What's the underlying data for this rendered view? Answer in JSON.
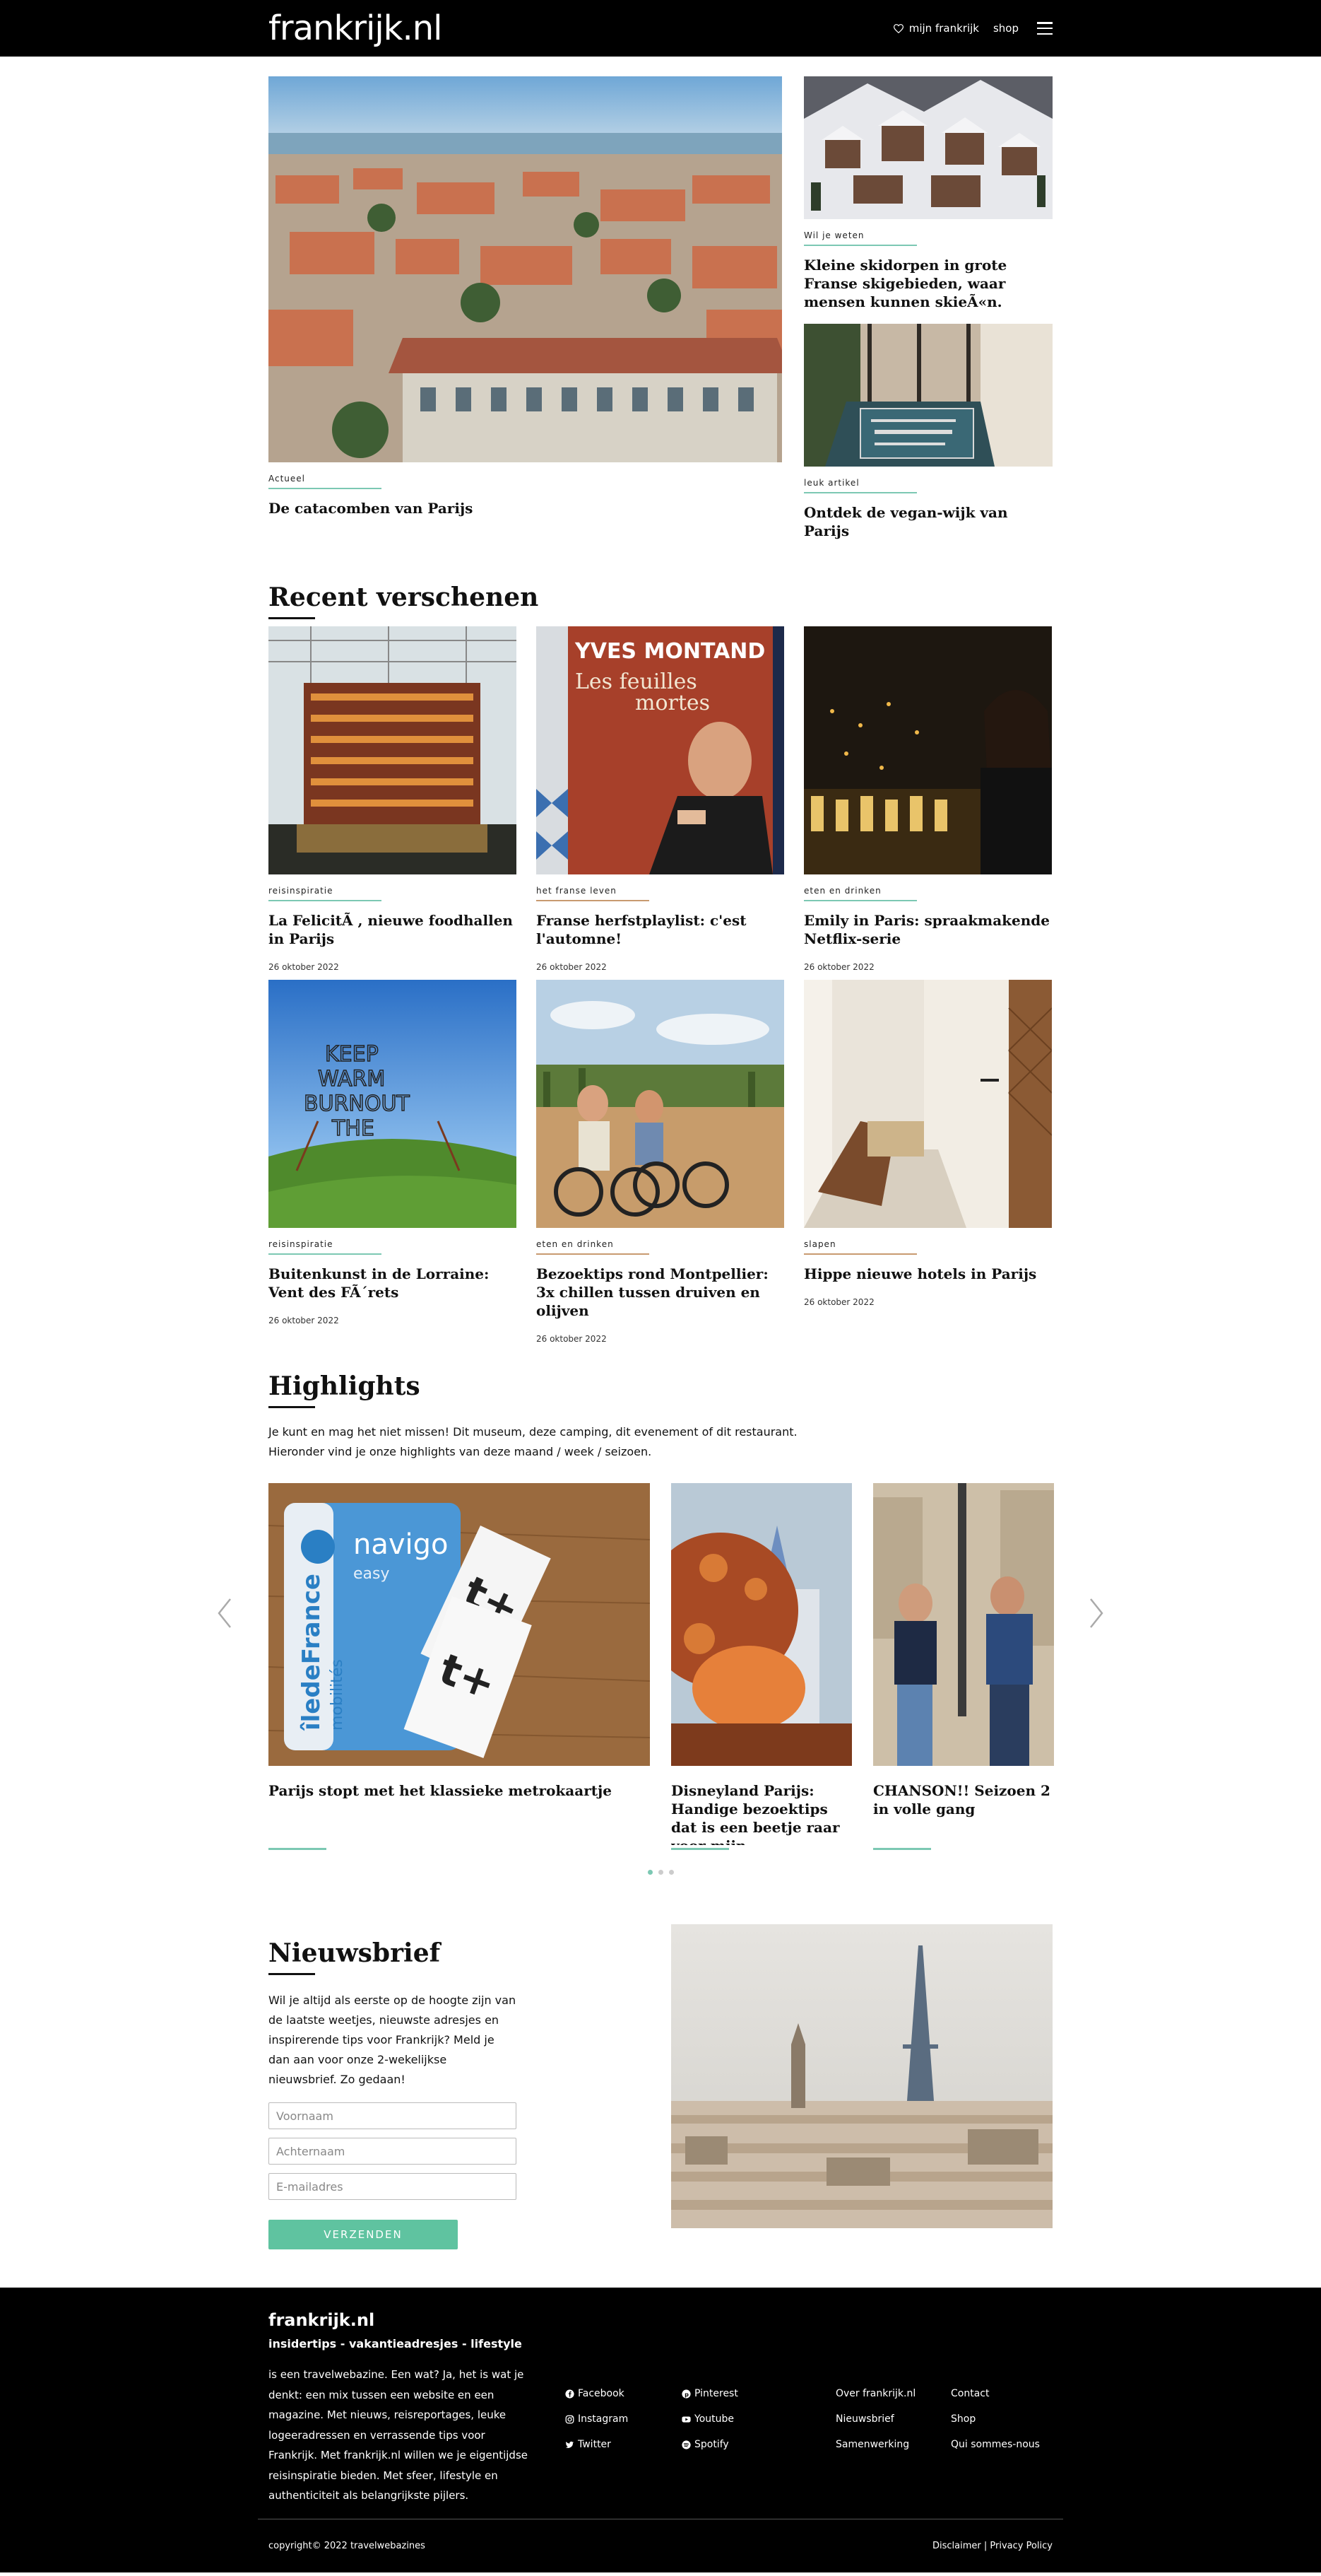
{
  "header": {
    "logo": "frankrijk.nl",
    "mijn_frankrijk": "mijn frankrijk",
    "shop": "shop",
    "heart_icon": "heart-icon",
    "menu_icon": "hamburger-menu-icon"
  },
  "featured": {
    "main": {
      "category": "Actueel",
      "title": "De catacomben van Parijs"
    },
    "side": [
      {
        "category": "Wil je weten",
        "title": "Kleine skidorpen in grote Franse skigebieden, waar mensen kunnen skieÃ«n."
      },
      {
        "category": "leuk artikel",
        "title": "Ontdek de vegan-wijk van Parijs"
      }
    ]
  },
  "recent": {
    "heading": "Recent verschenen",
    "items": [
      {
        "category": "reisinspiratie",
        "title": "La FelicitÃ , nieuwe foodhallen in Parijs",
        "date": "26 oktober 2022",
        "accent": "#7cc8b3"
      },
      {
        "category": "het franse leven",
        "title": "Franse herfstplaylist: c'est l'automne!",
        "date": "26 oktober 2022",
        "accent": "#c89a70"
      },
      {
        "category": "eten en drinken",
        "title": "Emily in Paris: spraakmakende Netflix-serie",
        "date": "26 oktober 2022",
        "accent": "#7cc8b3"
      },
      {
        "category": "reisinspiratie",
        "title": "Buitenkunst in de Lorraine: Vent des FÃ´rets",
        "date": "26 oktober 2022",
        "accent": "#7cc8b3"
      },
      {
        "category": "eten en drinken",
        "title": "Bezoektips rond Montpellier: 3x chillen tussen druiven en olijven",
        "date": "26 oktober 2022",
        "accent": "#c89a70"
      },
      {
        "category": "slapen",
        "title": "Hippe nieuwe hotels in Parijs",
        "date": "26 oktober 2022",
        "accent": "#c89a70"
      }
    ]
  },
  "highlights": {
    "heading": "Highlights",
    "intro_1": "Je kunt en mag het niet missen! Dit museum, deze camping, dit evenement of dit restaurant.",
    "intro_2": "Hieronder vind je onze highlights van deze maand / week / seizoen.",
    "items": [
      {
        "title": "Parijs stopt met het klassieke metrokaartje"
      },
      {
        "title": "Disneyland Parijs: Handige bezoektips dat is een beetje raar voor mijn…"
      },
      {
        "title": "CHANSON!! Seizoen 2 in volle gang"
      }
    ],
    "photo_text": {
      "navigo": "navigo",
      "easy": "easy",
      "idf": "îledeFrance",
      "mobilites": "mobilités"
    },
    "active_slide": 1,
    "slide_count": 3
  },
  "newsletter": {
    "heading": "Nieuwsbrief",
    "text": "Wil je altijd als eerste op de hoogte zijn van de laatste weetjes, nieuwste adresjes en inspirerende tips voor Frankrijk? Meld je dan aan voor onze 2-wekelijkse nieuwsbrief. Zo gedaan!",
    "first_name_placeholder": "Voornaam",
    "last_name_placeholder": "Achternaam",
    "email_placeholder": "E-mailadres",
    "submit": "VERZENDEN"
  },
  "footer": {
    "logo": "frankrijk.nl",
    "tagline": "insidertips - vakantieadresjes - lifestyle",
    "description": "is een travelwebazine. Een wat? Ja, het is wat je denkt: een mix tussen een website en een magazine. Met nieuws, reisreportages, leuke logeeradressen en verrassende tips voor Frankrijk. Met frankrijk.nl willen we je eigentijdse reisinspiratie bieden. Met sfeer, lifestyle en authenticiteit als belangrijkste pijlers.",
    "social": [
      {
        "label": "Facebook",
        "icon": "facebook-icon"
      },
      {
        "label": "Pinterest",
        "icon": "pinterest-icon"
      },
      {
        "label": "Instagram",
        "icon": "instagram-icon"
      },
      {
        "label": "Youtube",
        "icon": "youtube-icon"
      },
      {
        "label": "Twitter",
        "icon": "twitter-icon"
      },
      {
        "label": "Spotify",
        "icon": "spotify-icon"
      }
    ],
    "links": [
      "Over frankrijk.nl",
      "Contact",
      "Nieuwsbrief",
      "Shop",
      "Samenwerking",
      "Qui sommes-nous"
    ],
    "copyright": "copyright© 2022 travelwebazines",
    "disclaimer": "Disclaimer",
    "separator": "|",
    "privacy": "Privacy Policy"
  },
  "colors": {
    "accent_green": "#7cc8b3",
    "accent_brown": "#c89a70",
    "button": "#5fc3a0",
    "header_bg": "#000000"
  }
}
